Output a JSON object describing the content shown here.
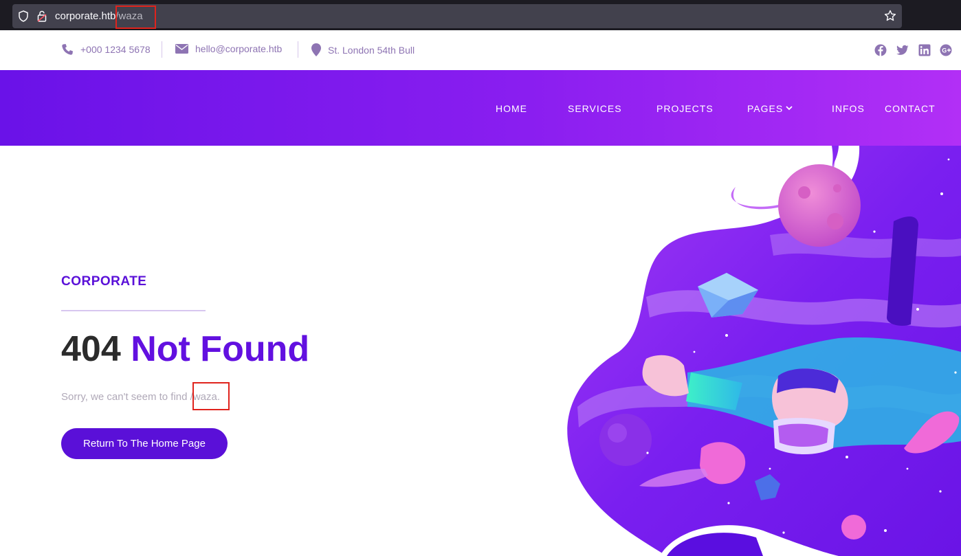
{
  "browser": {
    "url_host": "corporate.htb",
    "url_path": "/waza"
  },
  "topbar": {
    "phone": "+000 1234 5678",
    "email": "hello@corporate.htb",
    "address": "St. London 54th Bull",
    "social_icons": [
      "facebook-icon",
      "twitter-icon",
      "linkedin-icon",
      "google-plus-icon"
    ]
  },
  "nav": {
    "items": [
      {
        "label": "HOME"
      },
      {
        "label": "SERVICES"
      },
      {
        "label": "PROJECTS"
      },
      {
        "label": "PAGES"
      },
      {
        "label": "INFOS"
      },
      {
        "label": "CONTACT"
      }
    ]
  },
  "main": {
    "brand": "CORPORATE",
    "headline_code": "404",
    "headline_text": "Not Found",
    "sorry_prefix": "Sorry, we can't seem to find ",
    "sorry_path": "/waza.",
    "button_label": "Return To The Home Page"
  },
  "colors": {
    "accent": "#5a10d8",
    "nav_gradient_start": "#6a12e8",
    "nav_gradient_end": "#b22ff6",
    "highlight_box": "#e0231c"
  }
}
